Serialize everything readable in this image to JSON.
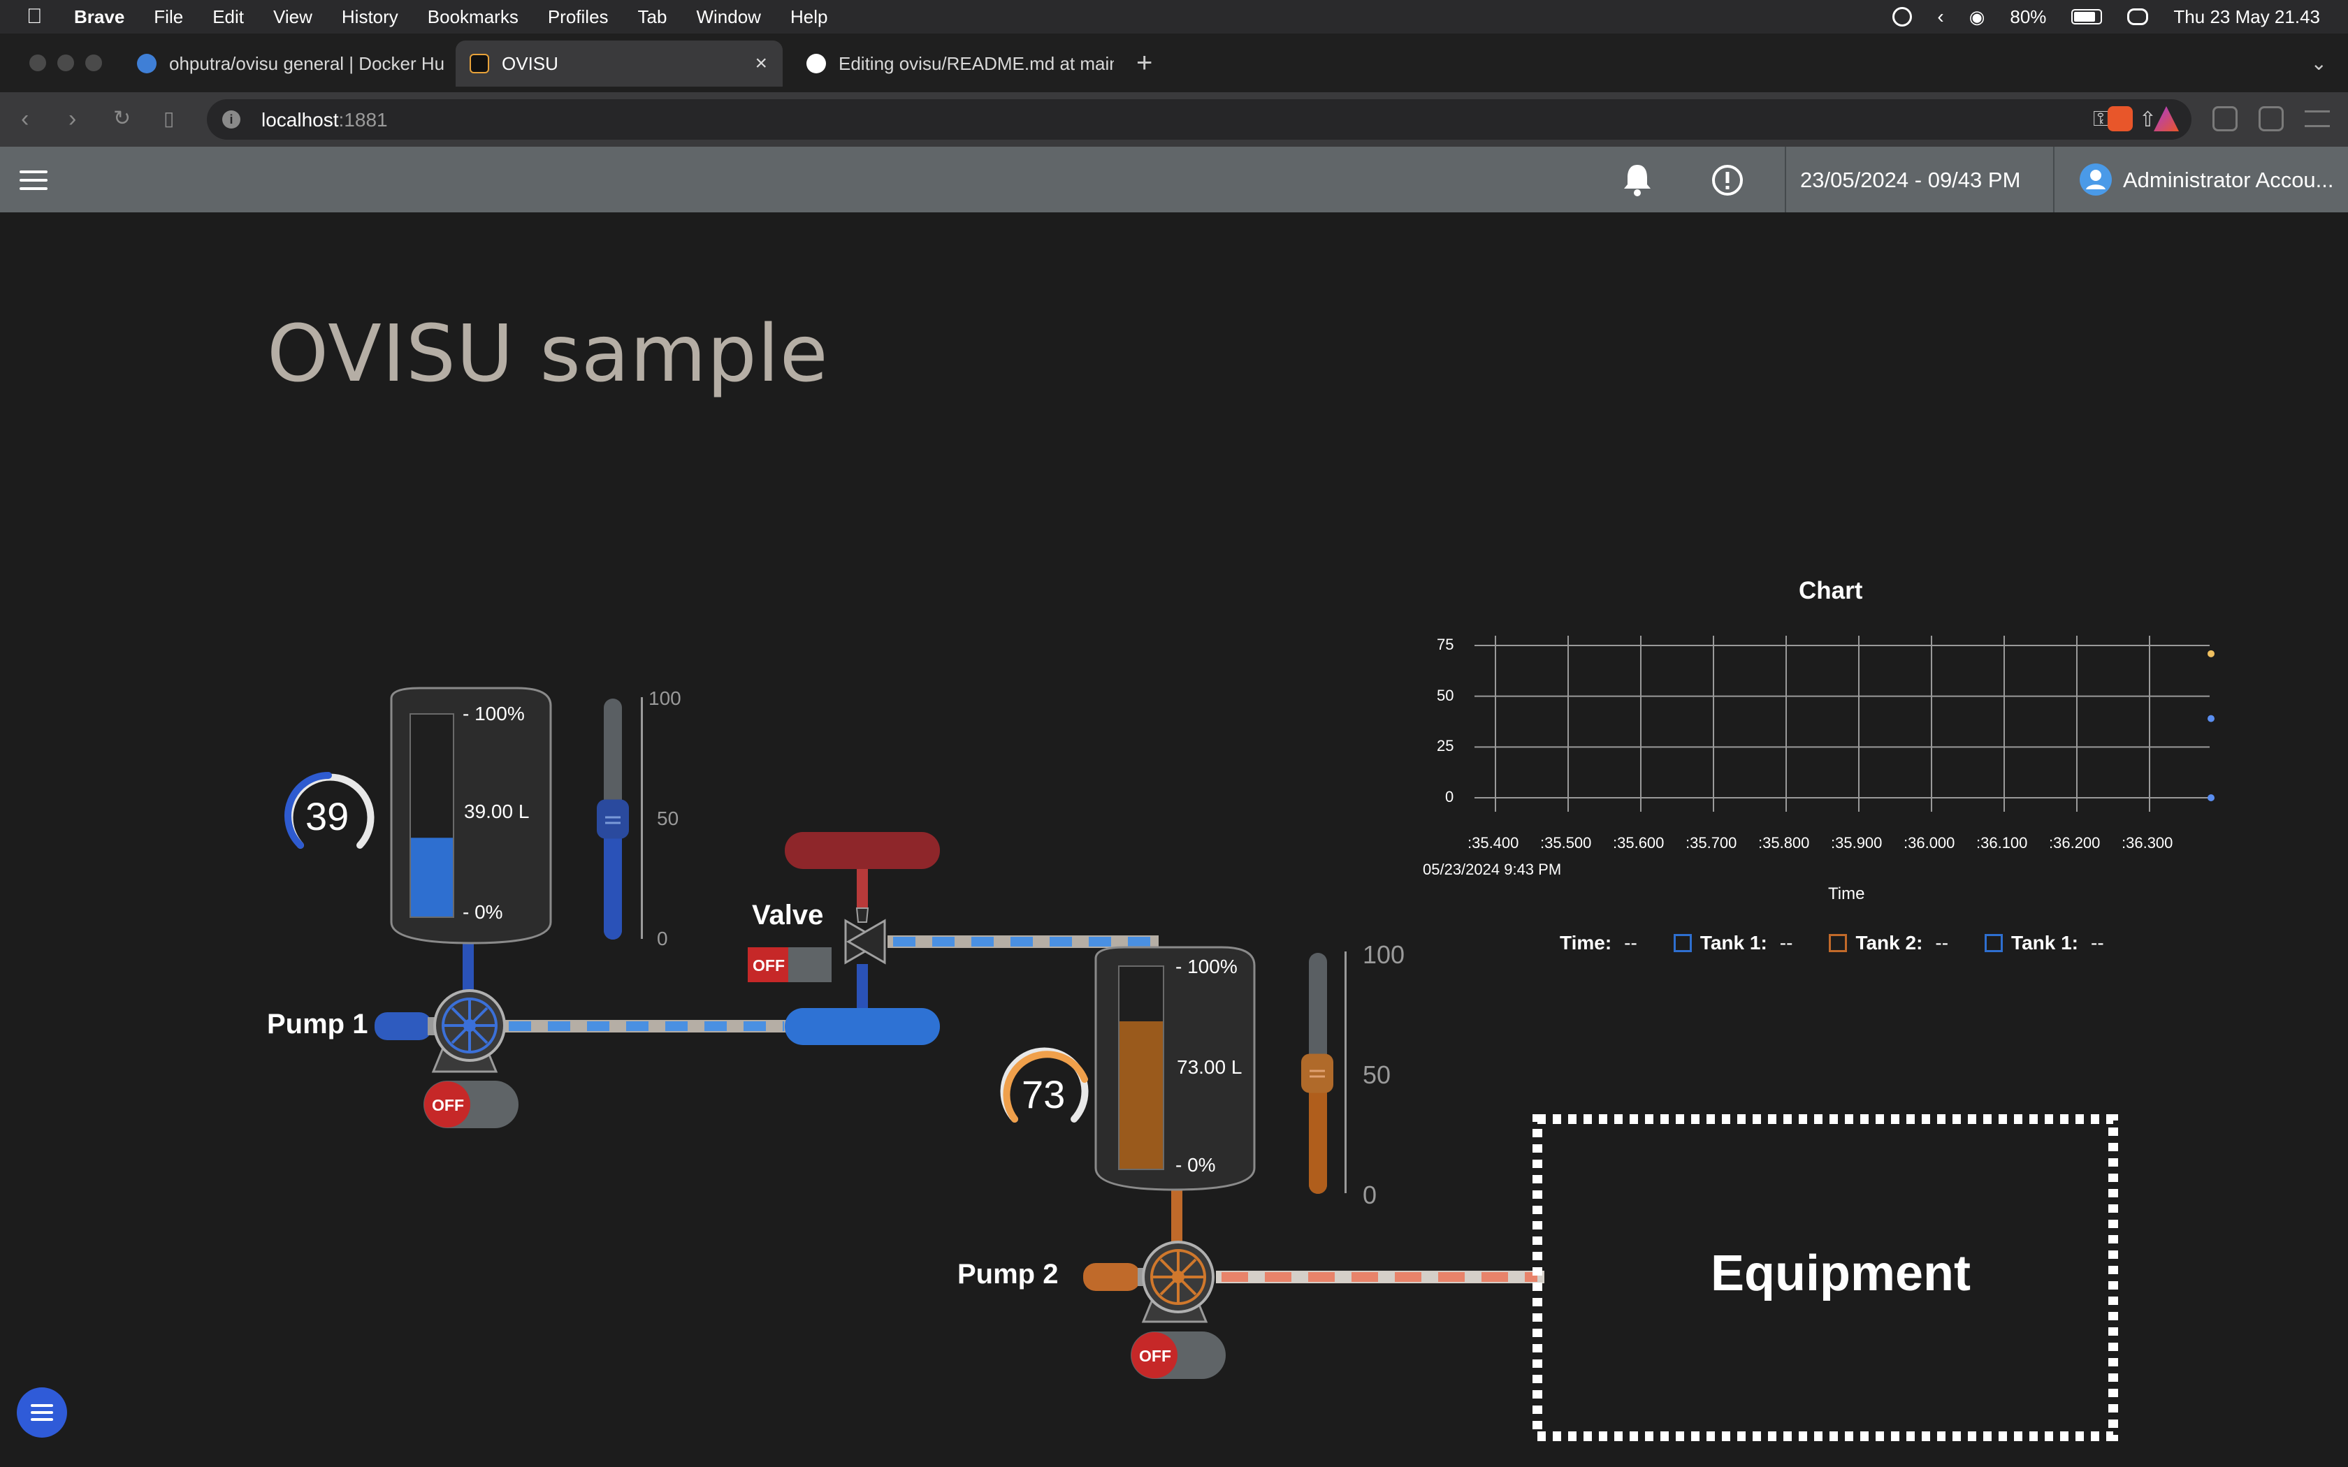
{
  "menubar": {
    "app": "Brave",
    "items": [
      "File",
      "Edit",
      "View",
      "History",
      "Bookmarks",
      "Profiles",
      "Tab",
      "Window",
      "Help"
    ],
    "battery": "80%",
    "clock": "Thu 23 May  21.43"
  },
  "browser": {
    "tabs": [
      {
        "title": "ohputra/ovisu general | Docker Hu"
      },
      {
        "title": "OVISU"
      },
      {
        "title": "Editing ovisu/README.md at main"
      }
    ],
    "url_host": "localhost",
    "url_port": ":1881"
  },
  "header": {
    "datetime": "23/05/2024 - 09/43 PM",
    "account": "Administrator Accou..."
  },
  "dashboard": {
    "title": "OVISU sample",
    "pump1_label": "Pump 1",
    "pump2_label": "Pump 2",
    "valve_label": "Valve",
    "switch_off": "OFF",
    "tank1": {
      "gauge": "39",
      "level_pct": 39,
      "top": "- 100%",
      "bottom": "- 0%",
      "volume": "39.00 L",
      "slider_value": 50,
      "slider_max": "100",
      "slider_mid": "50",
      "slider_min": "0"
    },
    "tank2": {
      "gauge": "73",
      "level_pct": 73,
      "top": "- 100%",
      "bottom": "- 0%",
      "volume": "73.00 L",
      "slider_value": 50,
      "slider_max": "100",
      "slider_mid": "50",
      "slider_min": "0"
    },
    "equipment": "Equipment",
    "colors": {
      "tank1": "#2e6fd0",
      "tank2": "#9a5a1c",
      "gauge2": "#f0a04b",
      "valve": "#8e262a",
      "off": "#c62828"
    }
  },
  "chart_data": {
    "type": "line",
    "title": "Chart",
    "xlabel": "Time",
    "x_ticks": [
      ":35.400",
      ":35.500",
      ":35.600",
      ":35.700",
      ":35.800",
      ":35.900",
      ":36.000",
      ":36.100",
      ":36.200",
      ":36.300"
    ],
    "x_date": "05/23/2024 9:43 PM",
    "y_ticks": [
      "75",
      "50",
      "25",
      "0"
    ],
    "ylim": [
      0,
      75
    ],
    "grid": true,
    "legend": {
      "time_label": "Time:",
      "items": [
        {
          "label": "Tank 1:",
          "value": "--",
          "color": "#2e6fd0"
        },
        {
          "label": "Tank 2:",
          "value": "--",
          "color": "#c26a2a"
        },
        {
          "label": "Tank 1:",
          "value": "--",
          "color": "#2e6fd0"
        }
      ],
      "time_value": "--"
    },
    "series_end_points": [
      {
        "y": 73,
        "color": "#f0c060"
      },
      {
        "y": 39,
        "color": "#5a8ef0"
      },
      {
        "y": 0,
        "color": "#5a8ef0"
      }
    ]
  }
}
